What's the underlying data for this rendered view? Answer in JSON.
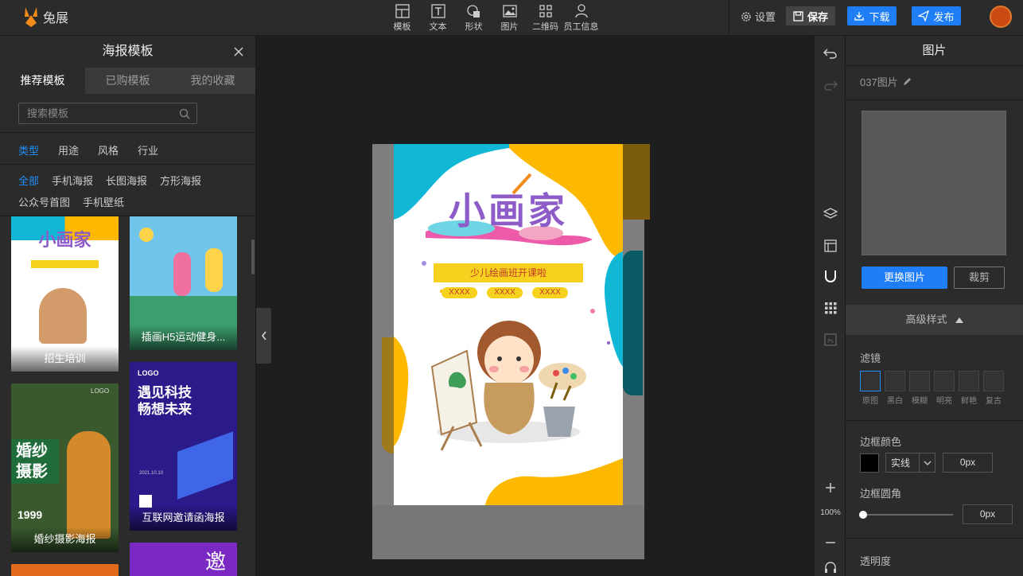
{
  "app": {
    "name": "兔展"
  },
  "toolbar": {
    "items": [
      {
        "label": "模板",
        "icon": "template-icon"
      },
      {
        "label": "文本",
        "icon": "text-icon"
      },
      {
        "label": "形状",
        "icon": "shape-icon"
      },
      {
        "label": "图片",
        "icon": "image-icon"
      },
      {
        "label": "二维码",
        "icon": "qrcode-icon"
      },
      {
        "label": "员工信息",
        "icon": "user-icon"
      }
    ],
    "settings_label": "设置",
    "save_label": "保存",
    "download_label": "下载",
    "publish_label": "发布"
  },
  "left_panel": {
    "title": "海报模板",
    "tabs": [
      "推荐模板",
      "已购模板",
      "我的收藏"
    ],
    "search_placeholder": "搜索模板",
    "category_tabs": [
      "类型",
      "用途",
      "风格",
      "行业"
    ],
    "subcategories": [
      "全部",
      "手机海报",
      "长图海报",
      "方形海报",
      "公众号首图",
      "手机壁纸"
    ],
    "templates": [
      {
        "caption": "招生培训",
        "title": "小画家"
      },
      {
        "caption": "插画H5运动健身..."
      },
      {
        "caption": "婚纱摄影海报",
        "title": "婚纱摄影",
        "price": "1999",
        "logo": "LOGO"
      },
      {
        "caption": "互联网邀请函海报",
        "logo": "LOGO",
        "title": "遇见科技畅想未来",
        "date": "2021.10.10"
      },
      {
        "caption": ""
      },
      {
        "caption": "",
        "title": "邀"
      }
    ]
  },
  "poster": {
    "title": "小画家",
    "ribbon": "少儿绘画班开课啦",
    "pills": [
      "XXXX",
      "XXXX",
      "XXXX"
    ],
    "colors": {
      "cyan": "#11b8d6",
      "yellow": "#fcb900",
      "purple": "#8e5cc9"
    }
  },
  "strip": {
    "zoom": "100%"
  },
  "right_panel": {
    "title": "图片",
    "layer_name": "037图片",
    "replace_label": "更换图片",
    "crop_label": "裁剪",
    "advanced_label": "高级样式",
    "filter_label": "滤镜",
    "filters": [
      "原图",
      "黑白",
      "模糊",
      "明亮",
      "鲜艳",
      "复古"
    ],
    "border_color_label": "边框颜色",
    "border_style": "实线",
    "border_width": "0px",
    "border_radius_label": "边框圆角",
    "border_radius": "0px",
    "opacity_label": "透明度"
  }
}
